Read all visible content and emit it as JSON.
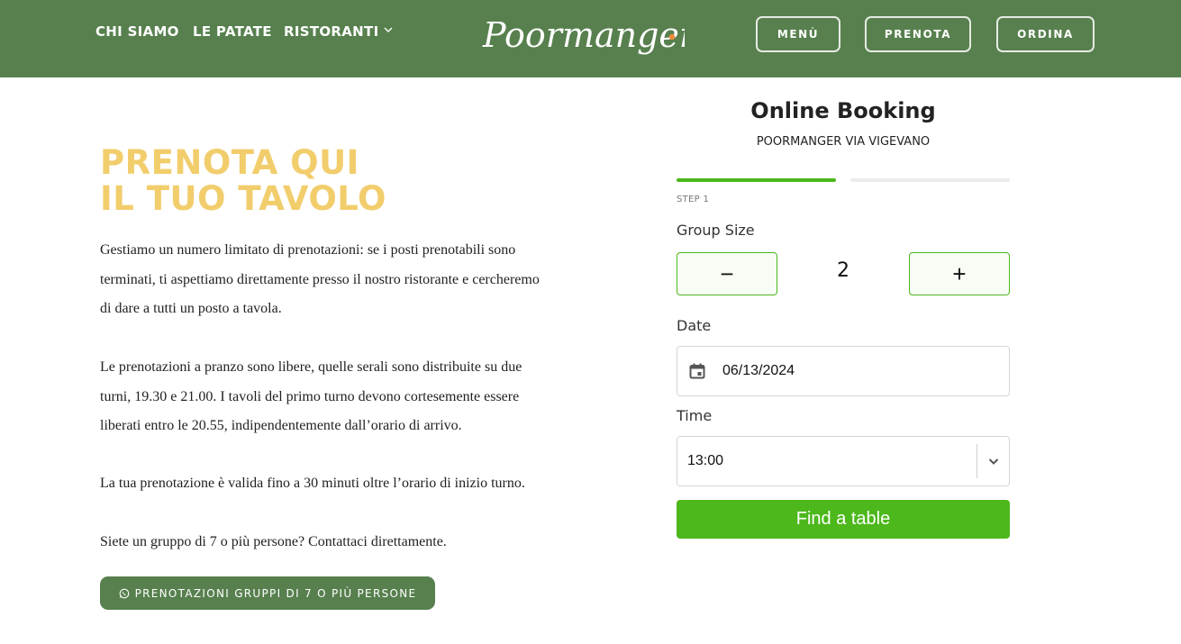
{
  "header": {
    "nav": [
      {
        "label": "CHI SIAMO"
      },
      {
        "label": "LE PATATE"
      },
      {
        "label": "RISTORANTI"
      }
    ],
    "logo_text": "Poormanger",
    "buttons": {
      "menu": "MENÙ",
      "prenota": "PRENOTA",
      "ordina": "ORDINA"
    }
  },
  "intro": {
    "headline_line1": "PRENOTA QUI",
    "headline_line2": "IL TUO TAVOLO",
    "paragraphs": [
      "Gestiamo un numero limitato di prenotazioni: se i posti prenotabili sono terminati, ti aspettiamo direttamente presso il nostro ristorante e cercheremo di dare a tutti un posto a tavola.",
      "Le prenotazioni a pranzo sono libere, quelle serali sono distribuite su due turni, 19.30 e 21.00. I tavoli del primo turno devono cortesemente essere liberati entro le 20.55, indipendentemente dall’orario di arrivo.",
      "La tua prenotazione è valida fino a 30 minuti oltre l’orario di inizio turno.",
      "Siete un gruppo di 7 o più persone? Contattaci direttamente."
    ],
    "group_button": "PRENOTAZIONI GRUPPI DI 7 O PIÙ PERSONE"
  },
  "booking": {
    "title": "Online Booking",
    "subtitle": "POORMANGER VIA VIGEVANO",
    "step_label": "STEP 1",
    "group_size_label": "Group Size",
    "group_size_value": "2",
    "minus_symbol": "−",
    "plus_symbol": "+",
    "date_label": "Date",
    "date_value": "06/13/2024",
    "time_label": "Time",
    "time_value": "13:00",
    "find_button": "Find a table"
  },
  "colors": {
    "header_green": "#57804e",
    "headline_yellow": "#f2cd6c",
    "accent_green": "#4cb81b",
    "logo_dot_orange": "#f08a3c"
  },
  "icons": [
    "chevron-down-icon",
    "whatsapp-icon",
    "calendar-icon",
    "minus-icon",
    "plus-icon"
  ]
}
